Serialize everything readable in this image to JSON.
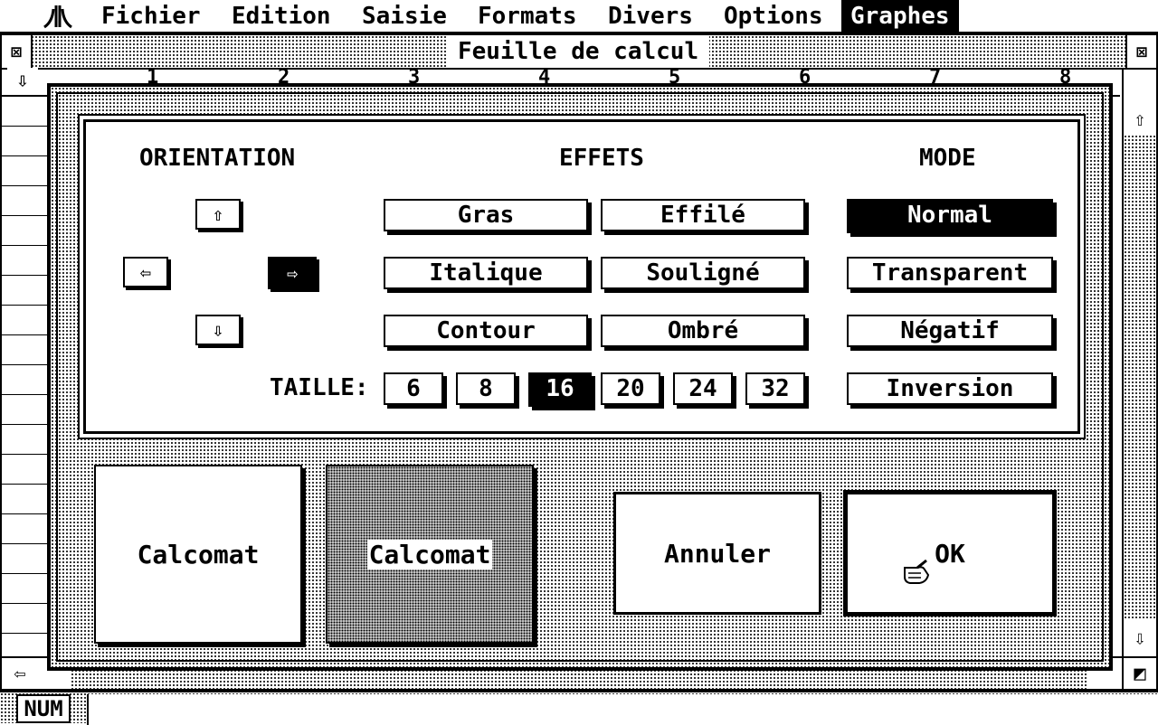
{
  "menubar": {
    "logo_icon": "atari-fuji-icon",
    "items": [
      "Fichier",
      "Edition",
      "Saisie",
      "Formats",
      "Divers",
      "Options",
      "Graphes"
    ],
    "active": "Graphes"
  },
  "window": {
    "title": "Feuille de calcul",
    "close_icon": "close-box-icon",
    "full_icon": "fuller-box-icon",
    "columns": [
      "1",
      "2",
      "3",
      "4",
      "5",
      "6",
      "7",
      "8"
    ],
    "status_mode": "NUM"
  },
  "dialog": {
    "orientation": {
      "heading": "ORIENTATION",
      "buttons": [
        {
          "name": "up",
          "icon": "arrow-up-icon",
          "glyph": "⇧"
        },
        {
          "name": "left",
          "icon": "arrow-left-icon",
          "glyph": "⇦"
        },
        {
          "name": "right",
          "icon": "arrow-right-icon",
          "glyph": "⇨",
          "selected": true
        },
        {
          "name": "down",
          "icon": "arrow-down-icon",
          "glyph": "⇩"
        }
      ]
    },
    "effets": {
      "heading": "EFFETS",
      "buttons": [
        "Gras",
        "Effilé",
        "Italique",
        "Souligné",
        "Contour",
        "Ombré"
      ]
    },
    "mode": {
      "heading": "MODE",
      "buttons": [
        "Normal",
        "Transparent",
        "Négatif",
        "Inversion"
      ],
      "selected": "Normal"
    },
    "taille": {
      "label": "TAILLE:",
      "sizes": [
        "6",
        "8",
        "16",
        "20",
        "24",
        "32"
      ],
      "selected": "16"
    },
    "preview_text": "Calcomat",
    "preview_text_2": "Calcomat",
    "cancel_label": "Annuler",
    "ok_label": "OK",
    "cursor_icon": "pointing-hand-cursor-icon"
  }
}
